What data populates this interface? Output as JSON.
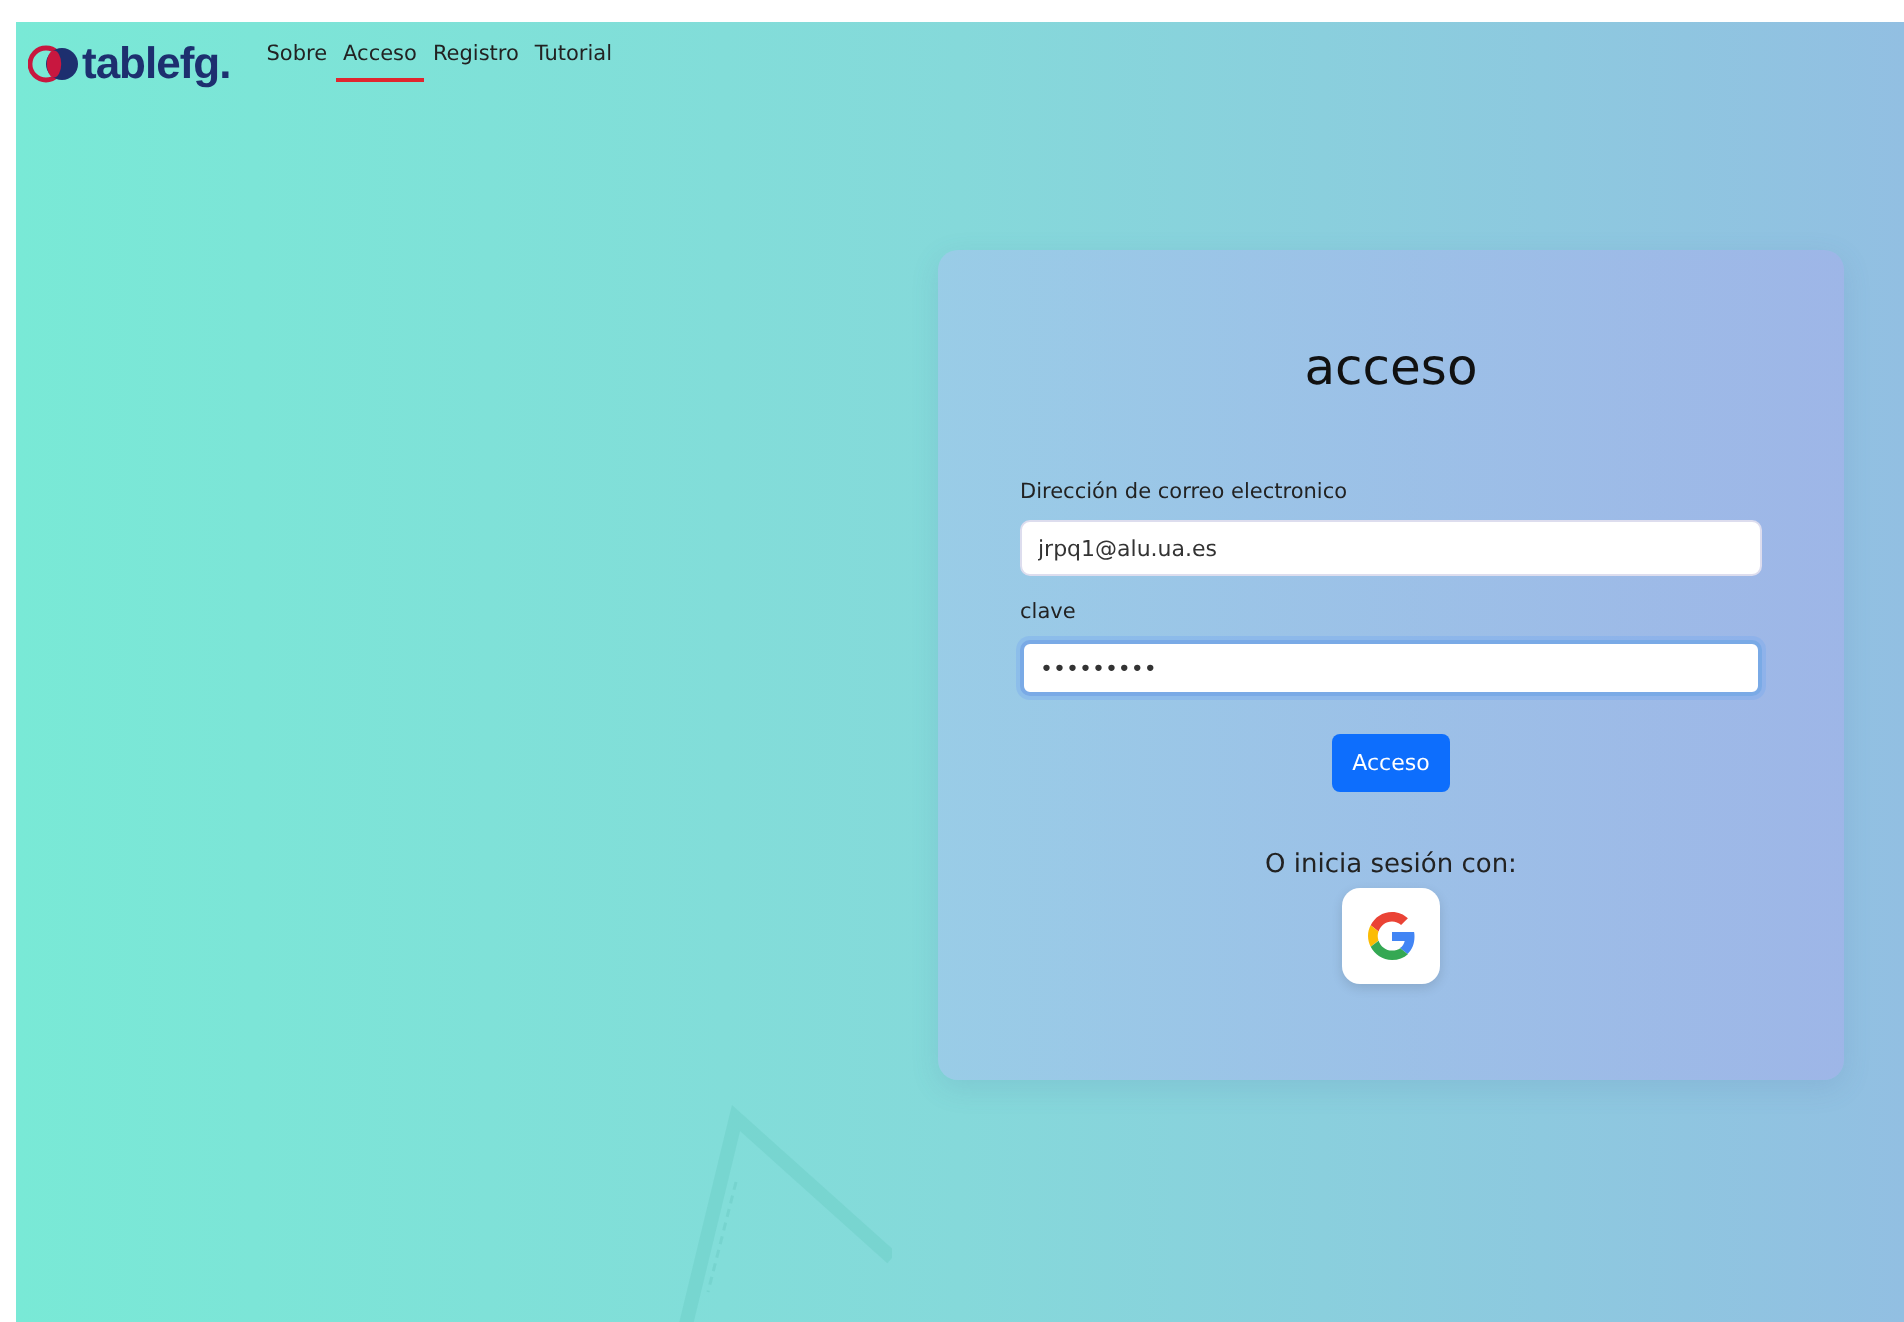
{
  "logo": {
    "text": "tablefg."
  },
  "nav": [
    {
      "label": "Sobre",
      "selected": false
    },
    {
      "label": "Acceso",
      "selected": true
    },
    {
      "label": "Registro",
      "selected": false
    },
    {
      "label": "Tutorial",
      "selected": false
    }
  ],
  "login": {
    "title": "acceso",
    "fields": [
      {
        "label": "Dirección de correo electronico",
        "value": "jrpq1@alu.ua.es",
        "focused": false
      },
      {
        "label": "clave",
        "value": "•••••••••",
        "focused": true
      }
    ],
    "submit": "Acceso",
    "alt_text": "O inicia sesión con:"
  }
}
